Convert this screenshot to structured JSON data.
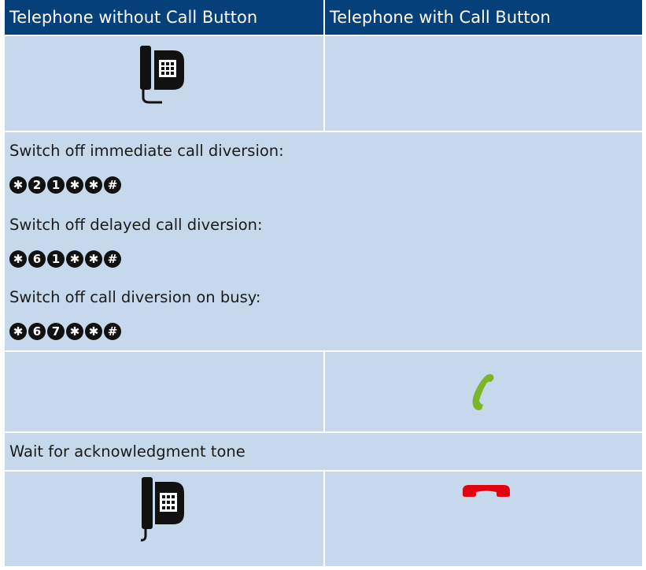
{
  "table": {
    "headers": [
      "Telephone without Call Button",
      "Telephone with Call Button"
    ],
    "steps": [
      {
        "text": "Switch off immediate call diversion:",
        "keys": [
          "✱",
          "2",
          "1",
          "✱",
          "✱",
          "#"
        ]
      },
      {
        "text": "Switch off delayed call diversion:",
        "keys": [
          "✱",
          "6",
          "1",
          "✱",
          "✱",
          "#"
        ]
      },
      {
        "text": "Switch off call diversion on busy:",
        "keys": [
          "✱",
          "6",
          "7",
          "✱",
          "✱",
          "#"
        ]
      }
    ],
    "wait_text": "Wait for acknowledgment tone"
  },
  "icons": {
    "desk_phone": "desk-phone-icon",
    "call_button": "green-handset-icon",
    "hangup_button": "red-handset-icon"
  },
  "colors": {
    "header_bg": "#06407a",
    "cell_bg": "#c6d9ec",
    "call_green": "#7ab628",
    "hangup_red": "#e3000f"
  }
}
